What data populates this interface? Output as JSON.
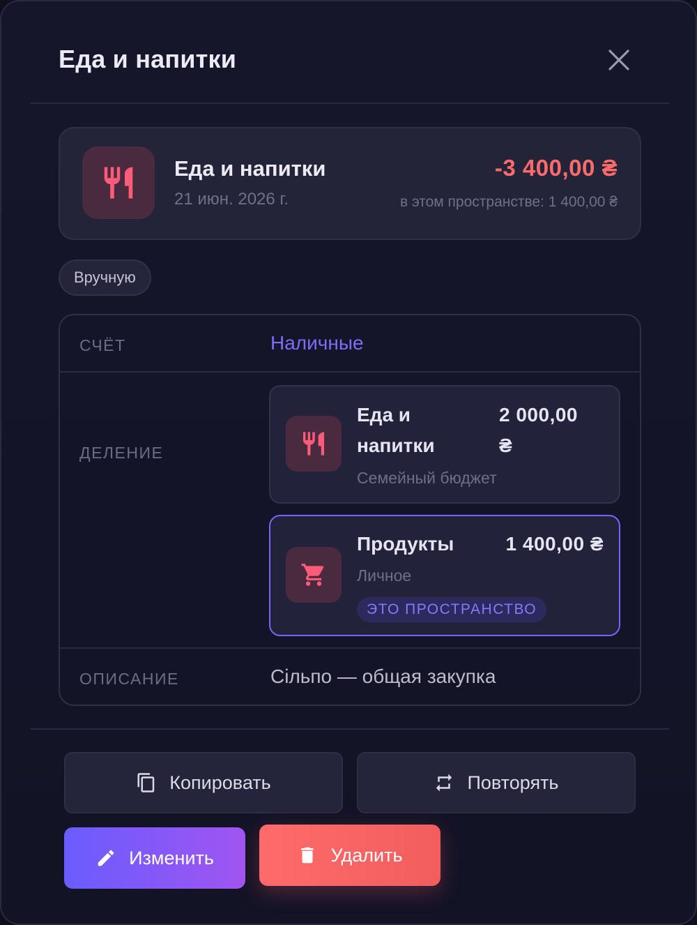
{
  "header": {
    "title": "Еда и напитки"
  },
  "summary": {
    "title": "Еда и напитки",
    "date": "21 июн. 2026 г.",
    "amount": "-3 400,00 ₴",
    "space_amount": "в этом пространстве: 1 400,00 ₴",
    "icon": "restaurant-icon"
  },
  "chip": {
    "label": "Вручную"
  },
  "details": {
    "account_label": "СЧЁТ",
    "account_value": "Наличные",
    "split_label": "ДЕЛЕНИЕ",
    "splits": [
      {
        "name_line1": "Еда и",
        "name_line2": "напитки",
        "amount_line1": "2 000,00",
        "amount_line2": "₴",
        "budget": "Семейный бюджет",
        "icon": "restaurant-icon"
      },
      {
        "name": "Продукты",
        "amount": "1 400,00 ₴",
        "budget": "Личное",
        "badge": "ЭТО ПРОСТРАНСТВО",
        "icon": "shopping-cart-icon"
      }
    ],
    "description_label": "ОПИСАНИЕ",
    "description_value": "Сільпо — общая закупка"
  },
  "actions": {
    "copy_label": "Копировать",
    "repeat_label": "Повторять",
    "edit_label": "Изменить",
    "delete_label": "Удалить"
  },
  "colors": {
    "accent": "#7a64ff",
    "expense": "#ff6b6b",
    "icon_pink": "#ff5c7a"
  }
}
